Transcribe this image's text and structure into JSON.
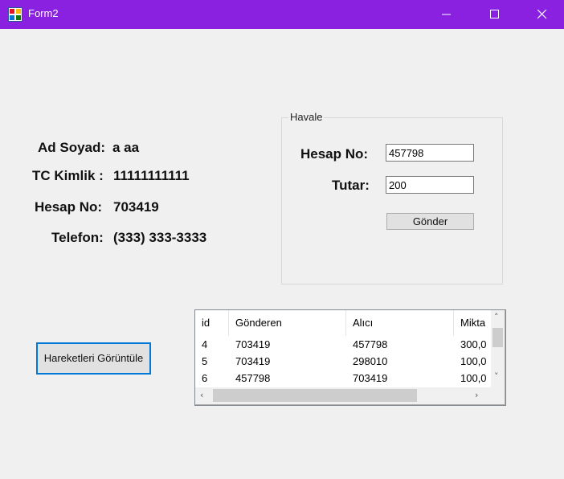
{
  "window": {
    "title": "Form2"
  },
  "profile": {
    "name_label": "Ad Soyad:",
    "name_value": "a aa",
    "tc_label": "TC Kimlik :",
    "tc_value": "11111111111",
    "account_label": "Hesap No:",
    "account_value": "703419",
    "phone_label": "Telefon:",
    "phone_value": "(333) 333-3333"
  },
  "transfer": {
    "group_title": "Havale",
    "account_label": "Hesap No:",
    "account_value": "457798",
    "amount_label": "Tutar:",
    "amount_value": "200",
    "send_button": "Gönder"
  },
  "history_button": "Hareketleri Görüntüle",
  "grid": {
    "columns": [
      "id",
      "Gönderen",
      "Alıcı",
      "Mikta"
    ],
    "rows": [
      [
        "4",
        "703419",
        "457798",
        "300,0"
      ],
      [
        "5",
        "703419",
        "298010",
        "100,0"
      ],
      [
        "6",
        "457798",
        "703419",
        "100,0"
      ]
    ]
  }
}
